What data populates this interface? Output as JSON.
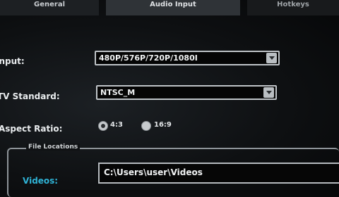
{
  "tabs": [
    {
      "label": "General"
    },
    {
      "label": "Audio Input"
    },
    {
      "label": "Hotkeys"
    }
  ],
  "settings": {
    "input_label": "Input:",
    "input_value": "480P/576P/720P/1080I",
    "tv_standard_label": "TV Standard:",
    "tv_standard_value": "NTSC_M",
    "aspect_ratio_label": "Aspect Ratio:",
    "aspect_options": [
      {
        "label": "4:3",
        "selected": true
      },
      {
        "label": "16:9",
        "selected": false
      }
    ]
  },
  "file_locations": {
    "legend": "File Locations",
    "videos_label": "Videos:",
    "videos_path": "C:\\Users\\user\\Videos"
  }
}
